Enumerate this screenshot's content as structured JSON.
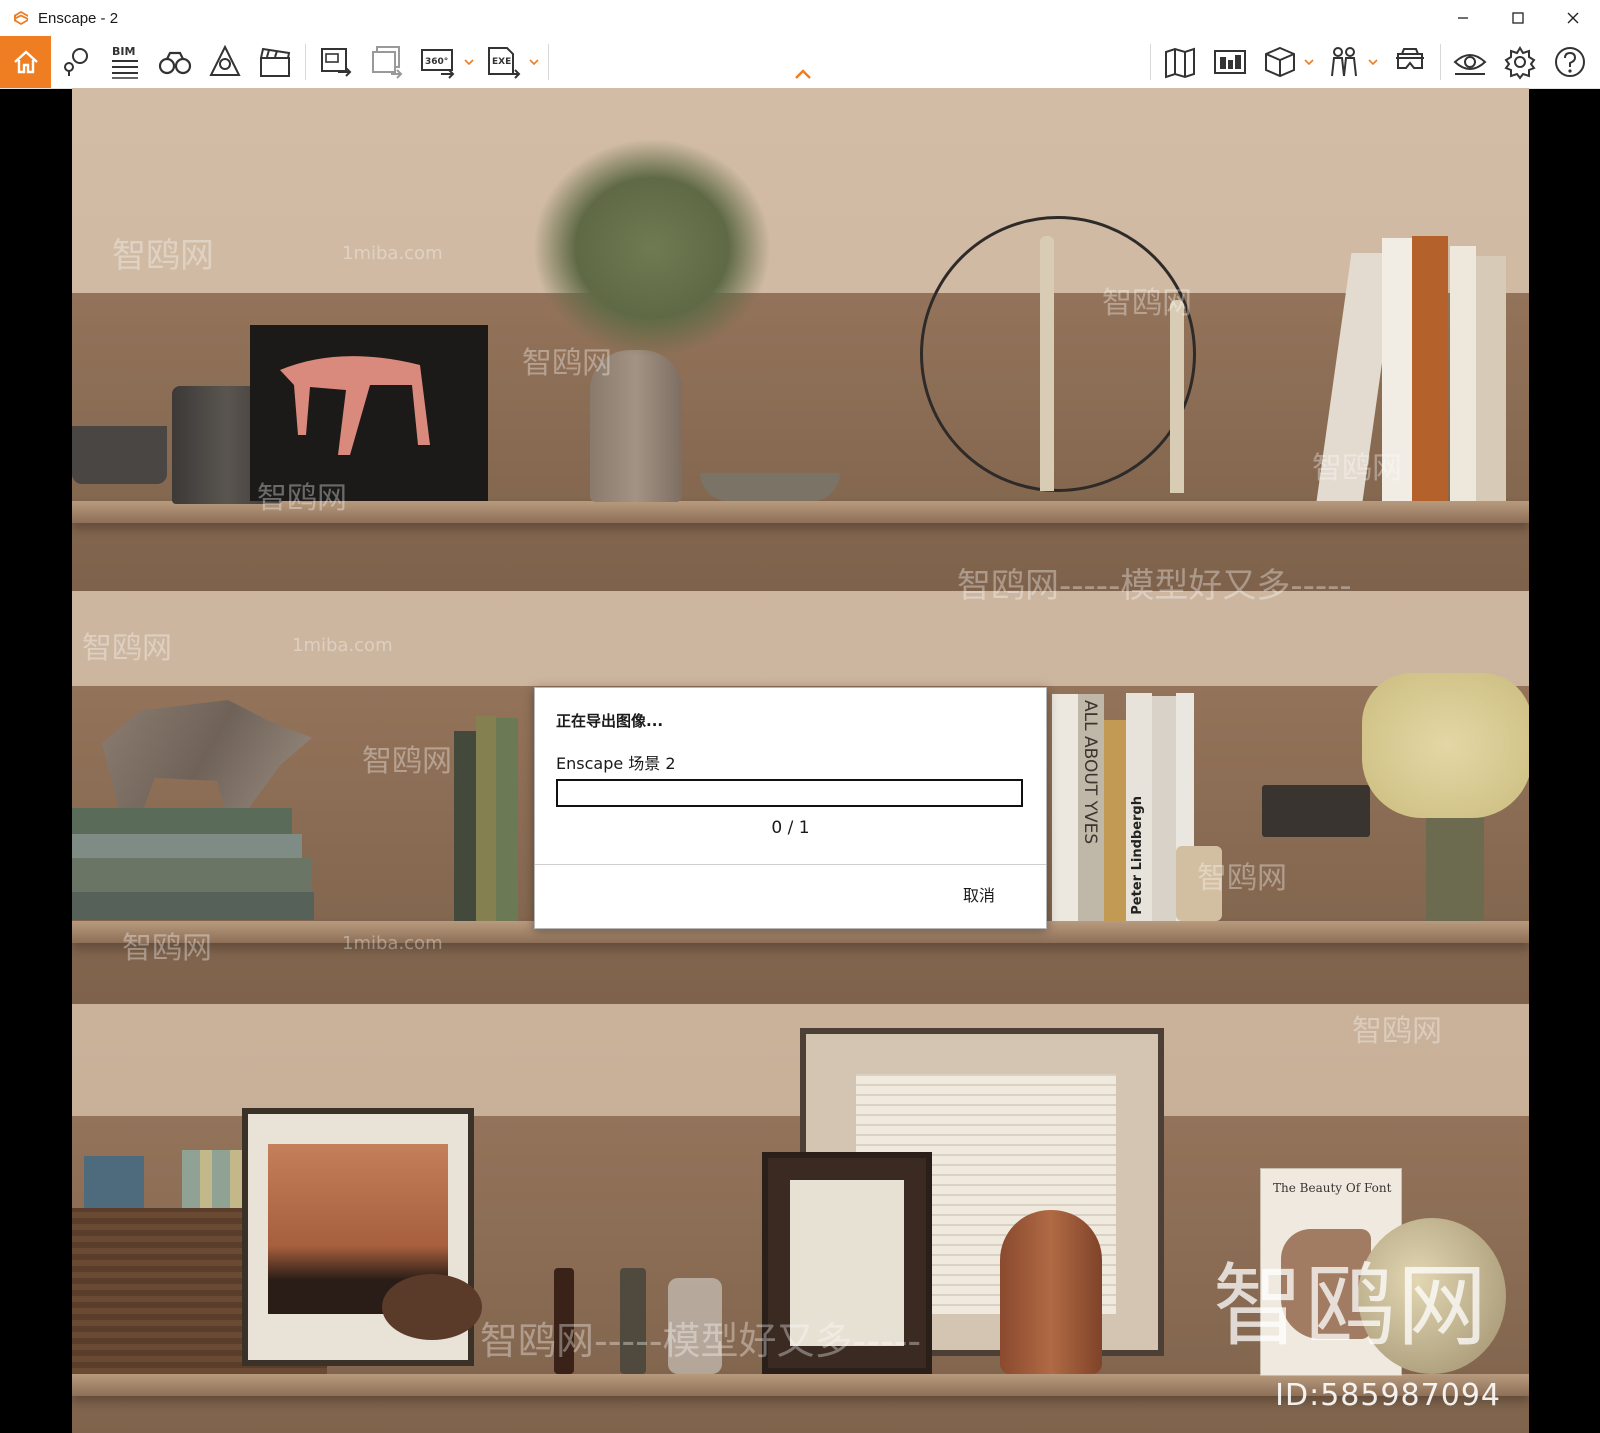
{
  "window": {
    "title": "Enscape - 2"
  },
  "toolbar": {
    "bim_label": "BIM",
    "render360_label": "360°",
    "exe_label": "EXE",
    "accent_color": "#ef7d22",
    "left_icons": [
      "home-icon",
      "pin-views-icon",
      "bim-info-icon",
      "binoculars-icon",
      "asset-library-icon",
      "clapperboard-icon",
      "render-image-icon",
      "batch-render-icon",
      "render-360-icon",
      "export-exe-icon"
    ],
    "right_icons": [
      "map-icon",
      "site-context-icon",
      "cube-view-icon",
      "people-icon",
      "vr-headset-icon",
      "visual-settings-icon",
      "settings-gear-icon",
      "help-icon"
    ]
  },
  "scene": {
    "book_titles": [
      "ALL ABOUT YVES",
      "Peter Lindbergh",
      "The Beauty Of Font"
    ]
  },
  "watermark": {
    "brand": "智鸥网",
    "slogan": "智鸥网-----模型好又多-----",
    "domain": "1miba.com",
    "big_logo": "智鸥网",
    "id_text": "ID:585987094"
  },
  "dialog": {
    "title": "正在导出图像...",
    "scene_name": "Enscape 场景 2",
    "progress_text": "0 / 1",
    "progress_fraction": 0,
    "cancel_label": "取消"
  }
}
